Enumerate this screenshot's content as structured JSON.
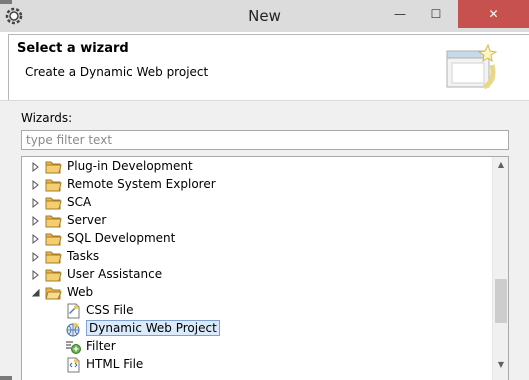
{
  "window": {
    "title": "New",
    "minimize_glyph": "—",
    "maximize_glyph": "☐",
    "close_glyph": "✕"
  },
  "header": {
    "title": "Select a wizard",
    "description": "Create a Dynamic Web project",
    "graphic_icon": "wizard-banner-icon"
  },
  "wizards": {
    "label": "Wizards:",
    "filter_placeholder": "type filter text",
    "filter_value": ""
  },
  "tree": {
    "items": [
      {
        "label": "Plug-in Development",
        "expanded": false,
        "icon": "folder-icon"
      },
      {
        "label": "Remote System Explorer",
        "expanded": false,
        "icon": "folder-icon"
      },
      {
        "label": "SCA",
        "expanded": false,
        "icon": "folder-icon"
      },
      {
        "label": "Server",
        "expanded": false,
        "icon": "folder-icon"
      },
      {
        "label": "SQL Development",
        "expanded": false,
        "icon": "folder-icon"
      },
      {
        "label": "Tasks",
        "expanded": false,
        "icon": "folder-icon"
      },
      {
        "label": "User Assistance",
        "expanded": false,
        "icon": "folder-icon"
      },
      {
        "label": "Web",
        "expanded": true,
        "icon": "open-folder-icon"
      },
      {
        "label": "CSS File",
        "icon": "css-file-icon"
      },
      {
        "label": "Dynamic Web Project",
        "icon": "web-project-icon",
        "selected": true
      },
      {
        "label": "Filter",
        "icon": "filter-icon"
      },
      {
        "label": "HTML File",
        "icon": "html-file-icon"
      }
    ]
  },
  "colors": {
    "titlebar": "#dcdcdc",
    "close_button": "#c7514e",
    "selection_fill": "#dbeafb",
    "selection_border": "#7da2ce",
    "folder": "#e8b64c"
  }
}
